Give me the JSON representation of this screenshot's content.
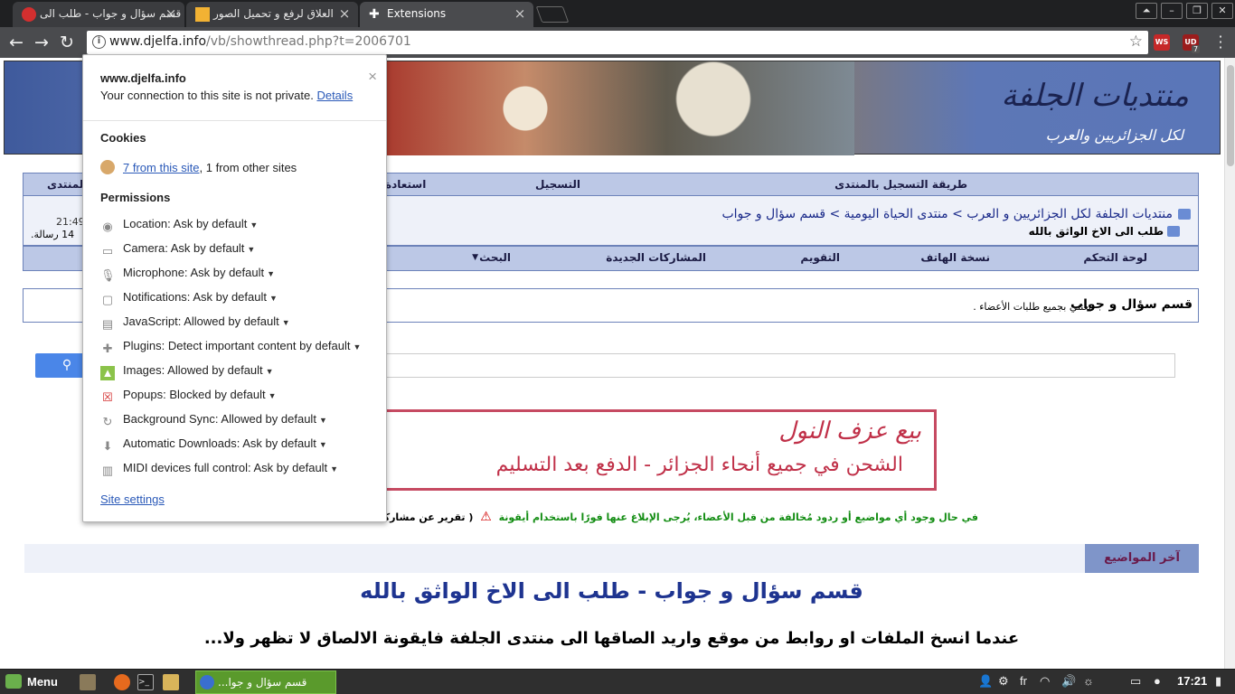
{
  "browser": {
    "tabs": [
      {
        "title": "قسم سؤال و جواب - طلب الى",
        "active": false
      },
      {
        "title": "العلاق لرفع و تحميل الصور",
        "active": false
      },
      {
        "title": "Extensions",
        "active": true
      }
    ],
    "url_host": "www.djelfa.info",
    "url_path": "/vb/showthread.php?t=2006701",
    "extensions": [
      {
        "label": "WS",
        "color": "#c62828"
      },
      {
        "label": "UD",
        "color": "#b71c1c",
        "badge": "7"
      }
    ]
  },
  "banner": {
    "logo": "منتديات الجلفة",
    "logo_sub": "لكل الجزائريين والعرب"
  },
  "topnav": [
    "طريقة التسجيل بالمنتدى",
    "التسجيل",
    "استعادة",
    "المنتدى"
  ],
  "breadcrumb": {
    "path": "منتديات الجلفة لكل الجزائريين و العرب > منتدى الحياة اليومية > قسم سؤال و جواب",
    "current": "طلب الى الاخ الواثق بالله",
    "time": "21:49",
    "messages": "14 رسالة."
  },
  "botnav": [
    "لوحة التحكم",
    "نسخة الهاتف",
    "التقويم",
    "المشاركات الجديدة",
    "البحث"
  ],
  "forum": {
    "title": "قسم سؤال و جواب",
    "desc": "يعتني بجميع طلبات الأعضاء ."
  },
  "ad": {
    "line1": "بيع عزف النول",
    "line2": "الشحن في جميع أنحاء الجزائر - الدفع بعد التسليم"
  },
  "warning": {
    "text": "في حال وجود أي مواضيع أو ردود مُخالفة من قبل الأعضاء، يُرجى الإبلاغ عنها فورًا باستخدام أيقونة",
    "link": "( تقرير عن مشاركة سيئة )"
  },
  "latest_tab": "آخر المواضيع",
  "post": {
    "title": "قسم سؤال و جواب - طلب الى الاخ الواثق بالله",
    "body": "عندما انسخ الملفات او روابط من موقع واريد الصاقها الى منتدى الجلفة فايقونة الالصاق لا تظهر ولا..."
  },
  "popup": {
    "site": "www.djelfa.info",
    "connection": "Your connection to this site is not private.",
    "details_link": "Details",
    "cookies_heading": "Cookies",
    "cookies_link": "7 from this site",
    "cookies_rest": ", 1 from other sites",
    "permissions_heading": "Permissions",
    "permissions": [
      {
        "name": "Location:",
        "value": "Ask by default",
        "icon": "location-icon"
      },
      {
        "name": "Camera:",
        "value": "Ask by default",
        "icon": "camera-icon"
      },
      {
        "name": "Microphone:",
        "value": "Ask by default",
        "icon": "microphone-icon"
      },
      {
        "name": "Notifications:",
        "value": "Ask by default",
        "icon": "notifications-icon"
      },
      {
        "name": "JavaScript:",
        "value": "Allowed by default",
        "icon": "javascript-icon"
      },
      {
        "name": "Plugins:",
        "value": "Detect important content by default",
        "icon": "plugins-icon"
      },
      {
        "name": "Images:",
        "value": "Allowed by default",
        "icon": "images-icon"
      },
      {
        "name": "Popups:",
        "value": "Blocked by default",
        "icon": "popups-blocked-icon"
      },
      {
        "name": "Background Sync:",
        "value": "Allowed by default",
        "icon": "sync-icon"
      },
      {
        "name": "Automatic Downloads:",
        "value": "Ask by default",
        "icon": "download-icon"
      },
      {
        "name": "MIDI devices full control:",
        "value": "Ask by default",
        "icon": "midi-icon"
      }
    ],
    "site_settings": "Site settings"
  },
  "taskbar": {
    "menu": "Menu",
    "window": "قسم سؤال و جوا...",
    "lang": "fr",
    "clock": "17:21"
  }
}
